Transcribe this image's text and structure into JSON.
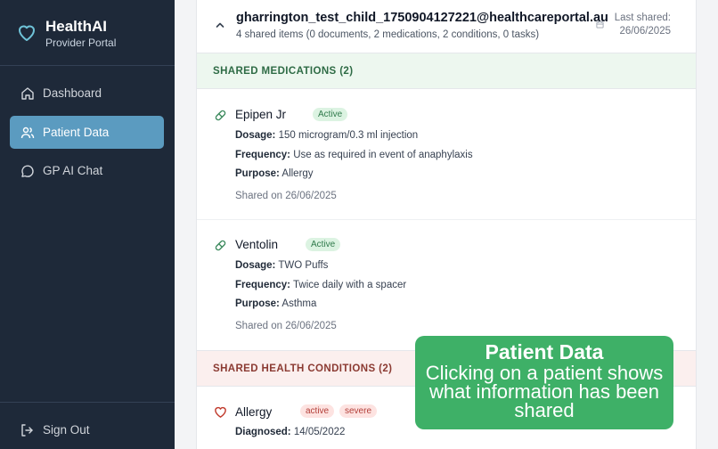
{
  "brand": {
    "title": "HealthAI",
    "subtitle": "Provider Portal"
  },
  "nav": {
    "items": [
      {
        "label": "Dashboard",
        "icon": "home-icon"
      },
      {
        "label": "Patient Data",
        "icon": "users-icon",
        "active": true
      },
      {
        "label": "GP AI Chat",
        "icon": "chat-icon"
      }
    ],
    "signout": "Sign Out"
  },
  "patient": {
    "email": "gharrington_test_child_1750904127221@healthcareportal.au",
    "summary": "4 shared items (0 documents, 2 medications, 2 conditions, 0 tasks)",
    "last_shared_label": "Last shared:",
    "last_shared_date": "26/06/2025"
  },
  "medications": {
    "title": "SHARED MEDICATIONS (2)",
    "items": [
      {
        "name": "Epipen Jr",
        "status": "Active",
        "dosage_label": "Dosage:",
        "dosage": "150 microgram/0.3 ml injection",
        "frequency_label": "Frequency:",
        "frequency": "Use as required in event of anaphylaxis",
        "purpose_label": "Purpose:",
        "purpose": "Allergy",
        "shared_on": "Shared on 26/06/2025"
      },
      {
        "name": "Ventolin",
        "status": "Active",
        "dosage_label": "Dosage:",
        "dosage": "TWO Puffs",
        "frequency_label": "Frequency:",
        "frequency": "Twice daily with a spacer",
        "purpose_label": "Purpose:",
        "purpose": "Asthma",
        "shared_on": "Shared on 26/06/2025"
      }
    ]
  },
  "conditions": {
    "title": "SHARED HEALTH CONDITIONS (2)",
    "items": [
      {
        "name": "Allergy",
        "status": "active",
        "severity": "severe",
        "diagnosed_label": "Diagnosed:",
        "diagnosed": "14/05/2022"
      }
    ]
  },
  "overlay": {
    "title": "Patient Data",
    "body": "Clicking on a patient shows what information has been shared"
  },
  "colors": {
    "sidebar_bg": "#1e2939",
    "nav_active": "#5b9bc0",
    "brand_accent": "#6fc3d8",
    "pill_icon": "#3e8b5f",
    "heart_icon": "#c0392b",
    "overlay_bg": "#3eb067"
  }
}
